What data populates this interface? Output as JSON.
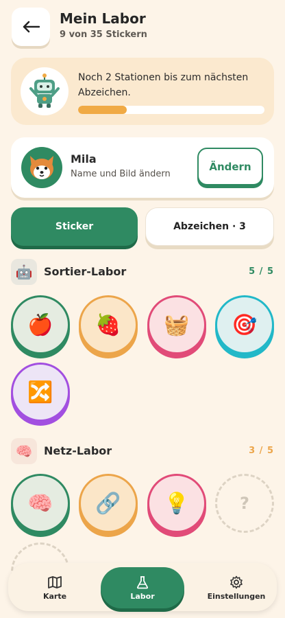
{
  "header": {
    "title": "Mein Labor",
    "subtitle": "9 von 35 Stickern",
    "back_icon": "arrow-left-icon"
  },
  "progress": {
    "text": "Noch 2 Stationen bis zum nächsten Abzeichen.",
    "fraction": 0.26,
    "color": "#f0aa45"
  },
  "profile": {
    "name": "Mila",
    "hint": "Name und Bild ändern",
    "edit_label": "Ändern"
  },
  "tabs": [
    {
      "label": "Sticker",
      "active": true
    },
    {
      "label": "Abzeichen · 3",
      "active": false
    }
  ],
  "sections": [
    {
      "title": "Sortier-Labor",
      "count": "5 / 5",
      "count_color": "#2f8a62",
      "icon": "🤖",
      "stickers": [
        "🍎",
        "🍓",
        "🧺",
        "🎯",
        "🔀"
      ]
    },
    {
      "title": "Netz-Labor",
      "count": "3 / 5",
      "count_color": "#eca54a",
      "icon": "🧠",
      "stickers": [
        "🧠",
        "🔗",
        "💡",
        "?"
      ]
    }
  ],
  "nav": [
    {
      "label": "Karte",
      "icon": "map-icon"
    },
    {
      "label": "Labor",
      "icon": "flask-icon",
      "active": true
    },
    {
      "label": "Einstellungen",
      "icon": "gear-icon"
    }
  ],
  "colors": {
    "brand": "#2f8a62",
    "background": "#fdf4e8"
  }
}
